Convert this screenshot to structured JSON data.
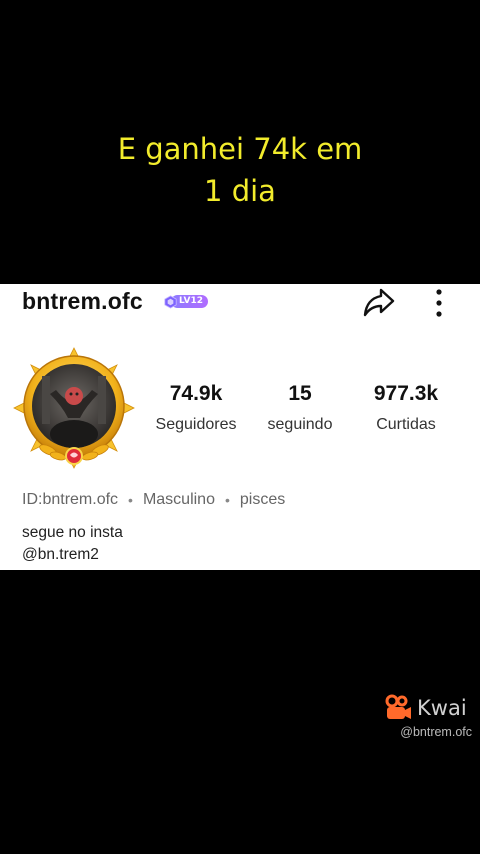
{
  "caption": {
    "line1": "E ganhei 74k em",
    "line2": "1 dia"
  },
  "profile": {
    "username": "bntrem.ofc",
    "level_badge": "LV12",
    "stats": [
      {
        "value": "74.9k",
        "label": "Seguidores"
      },
      {
        "value": "15",
        "label": "seguindo"
      },
      {
        "value": "977.3k",
        "label": "Curtidas"
      }
    ],
    "meta": {
      "id": "ID:bntrem.ofc",
      "gender": "Masculino",
      "sign": "pisces"
    },
    "bio": {
      "line1": "segue no insta",
      "line2": "@bn.trem2"
    },
    "icons": {
      "share": "share-icon",
      "more": "more-vertical-icon",
      "level": "level-gem-icon"
    }
  },
  "watermark": {
    "brand": "Kwai",
    "handle": "@bntrem.ofc"
  },
  "colors": {
    "caption": "#f2ec2c",
    "brand_orange": "#ff6a2b",
    "badge": "#9b74ff",
    "frame_gold": "#f2b21b"
  }
}
